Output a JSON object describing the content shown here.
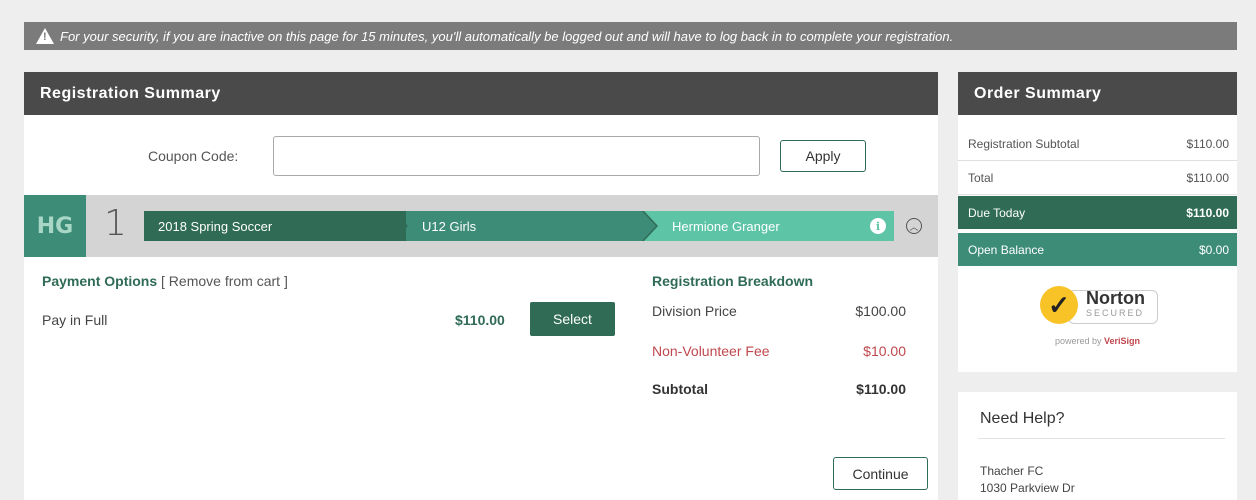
{
  "banner": {
    "icon": "warning-icon",
    "text": "For your security, if you are inactive on this page for 15 minutes, you'll automatically be logged out and will have to log back in to complete your registration."
  },
  "registration": {
    "title": "Registration Summary",
    "coupon_label": "Coupon Code:",
    "coupon_value": "",
    "apply_label": "Apply",
    "entry": {
      "initials": "HG",
      "number": "1",
      "program": "2018 Spring Soccer",
      "division": "U12 Girls",
      "participant": "Hermione Granger"
    },
    "payment_options_title": "Payment Options",
    "remove_label": "[ Remove from cart ]",
    "pay_in_full_label": "Pay in Full",
    "pay_in_full_price": "$110.00",
    "select_label": "Select",
    "breakdown": {
      "title": "Registration Breakdown",
      "rows": [
        {
          "label": "Division Price",
          "value": "$100.00"
        },
        {
          "label": "Non-Volunteer Fee",
          "value": "$10.00"
        },
        {
          "label": "Subtotal",
          "value": "$110.00"
        }
      ]
    },
    "continue_label": "Continue"
  },
  "order": {
    "title": "Order Summary",
    "rows": [
      {
        "label": "Registration Subtotal",
        "value": "$110.00"
      },
      {
        "label": "Total",
        "value": "$110.00"
      },
      {
        "label": "Due Today",
        "value": "$110.00"
      },
      {
        "label": "Open Balance",
        "value": "$0.00"
      }
    ],
    "badge": {
      "name": "Norton",
      "secured": "SECURED",
      "powered_by": "powered by",
      "brand": "VeriSign"
    }
  },
  "help": {
    "title": "Need Help?",
    "org": "Thacher FC",
    "address": "1030 Parkview Dr"
  },
  "colors": {
    "accent": "#2f6b55",
    "accent_light": "#5ec4a6",
    "fee": "#c0484e",
    "header": "#4a4a4a"
  }
}
